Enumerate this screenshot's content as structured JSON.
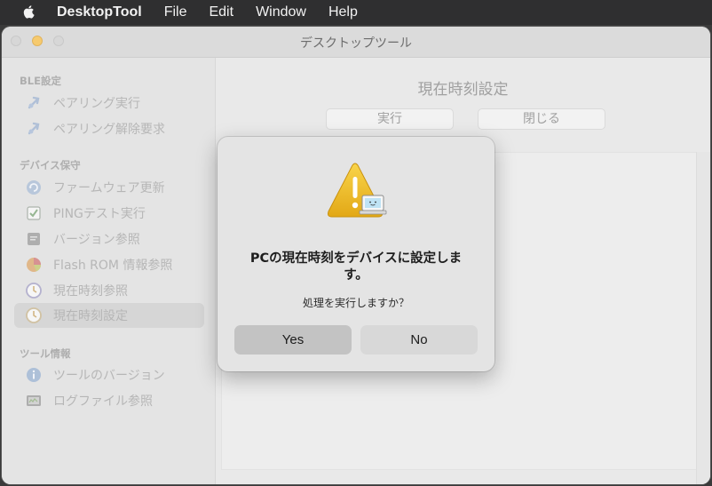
{
  "menubar": {
    "app_name": "DesktopTool",
    "menus": [
      "File",
      "Edit",
      "Window",
      "Help"
    ]
  },
  "window": {
    "title": "デスクトップツール"
  },
  "sidebar": {
    "sections": [
      {
        "label": "BLE設定",
        "items": [
          {
            "label": "ペアリング実行",
            "icon": "bluetooth-icon"
          },
          {
            "label": "ペアリング解除要求",
            "icon": "bluetooth-icon"
          }
        ]
      },
      {
        "label": "デバイス保守",
        "items": [
          {
            "label": "ファームウェア更新",
            "icon": "refresh-icon"
          },
          {
            "label": "PINGテスト実行",
            "icon": "checkbox-icon"
          },
          {
            "label": "バージョン参照",
            "icon": "document-icon"
          },
          {
            "label": "Flash ROM 情報参照",
            "icon": "pie-chart-icon"
          },
          {
            "label": "現在時刻参照",
            "icon": "clock-icon"
          },
          {
            "label": "現在時刻設定",
            "icon": "clock-icon",
            "selected": true
          }
        ]
      },
      {
        "label": "ツール情報",
        "items": [
          {
            "label": "ツールのバージョン",
            "icon": "info-icon"
          },
          {
            "label": "ログファイル参照",
            "icon": "log-icon"
          }
        ]
      }
    ]
  },
  "main": {
    "title": "現在時刻設定",
    "execute_label": "実行",
    "close_label": "閉じる"
  },
  "alert": {
    "message": "PCの現在時刻をデバイスに設定します。",
    "informative": "処理を実行しますか？",
    "yes_label": "Yes",
    "no_label": "No"
  },
  "colors": {
    "alert_warning": "#f2c230",
    "selected_item": "#cdcdcd",
    "minimize": "#f5bf4f"
  }
}
